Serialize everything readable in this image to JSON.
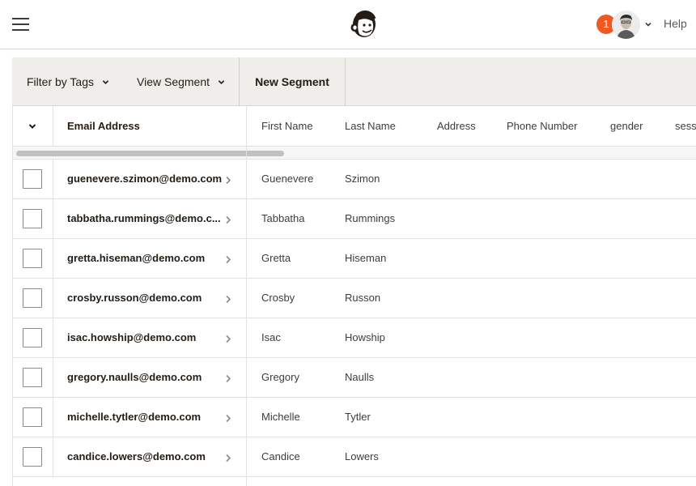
{
  "nav": {
    "notification_count": "1",
    "help_label": "Help",
    "accent_color": "#f05a22"
  },
  "toolbar": {
    "filter_label": "Filter by Tags",
    "view_label": "View Segment",
    "new_segment_label": "New Segment"
  },
  "table": {
    "columns": [
      "Email Address",
      "First Name",
      "Last Name",
      "Address",
      "Phone Number",
      "gender",
      "sess"
    ],
    "rows": [
      {
        "email": "guenevere.szimon@demo.com",
        "first": "Guenevere",
        "last": "Szimon"
      },
      {
        "email": "tabbatha.rummings@demo.c...",
        "first": "Tabbatha",
        "last": "Rummings"
      },
      {
        "email": "gretta.hiseman@demo.com",
        "first": "Gretta",
        "last": "Hiseman"
      },
      {
        "email": "crosby.russon@demo.com",
        "first": "Crosby",
        "last": "Russon"
      },
      {
        "email": "isac.howship@demo.com",
        "first": "Isac",
        "last": "Howship"
      },
      {
        "email": "gregory.naulls@demo.com",
        "first": "Gregory",
        "last": "Naulls"
      },
      {
        "email": "michelle.tytler@demo.com",
        "first": "Michelle",
        "last": "Tytler"
      },
      {
        "email": "candice.lowers@demo.com",
        "first": "Candice",
        "last": "Lowers"
      }
    ]
  },
  "icons": [
    "menu-icon",
    "mailchimp-logo-icon",
    "chevron-down-icon",
    "chevron-right-icon",
    "checkbox-icon"
  ]
}
